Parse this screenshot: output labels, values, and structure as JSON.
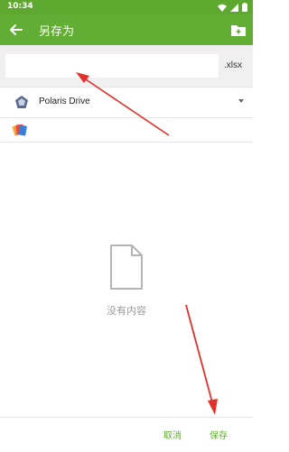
{
  "status_bar": {
    "time": "10:34"
  },
  "app_bar": {
    "title": "另存为",
    "back_icon": "arrow-left-icon",
    "new_folder_icon": "add-folder-icon"
  },
  "filename": {
    "value": "",
    "placeholder": "",
    "extension": ".xlsx"
  },
  "location": {
    "name": "Polaris Drive",
    "icon": "polaris-drive-icon",
    "dropdown_icon": "triangle-down-icon"
  },
  "empty_state": {
    "text": "没有内容",
    "icon": "document-icon"
  },
  "actions": {
    "cancel": "取消",
    "save": "保存"
  },
  "colors": {
    "primary": "#62ad33",
    "annotation": "#e2302b"
  }
}
